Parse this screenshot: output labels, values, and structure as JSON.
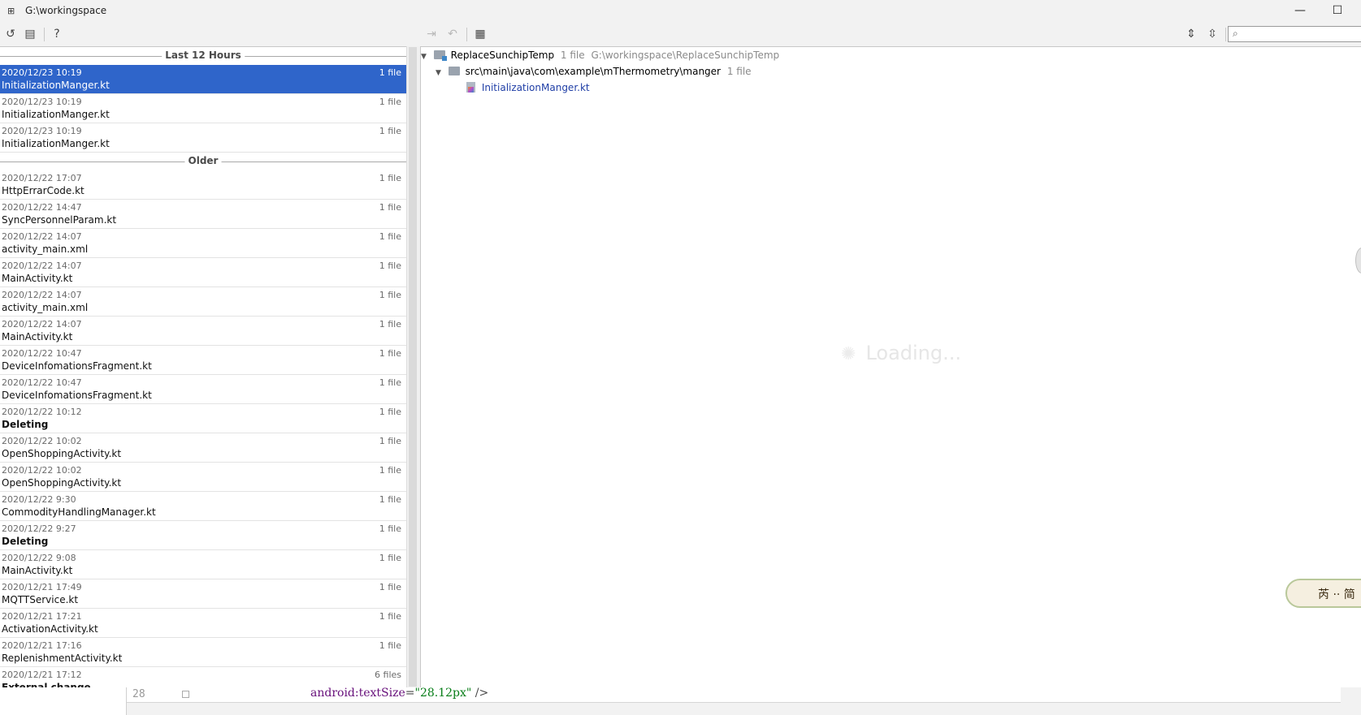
{
  "window": {
    "title": "G:\\workingspace",
    "minimize_glyph": "—",
    "maximize_glyph": "☐"
  },
  "toolbar": {
    "icons": [
      "revert-icon",
      "copy-icon",
      "help-icon",
      "apply-icon",
      "undo-icon",
      "grid-icon",
      "expand-all-icon",
      "collapse-all-icon"
    ],
    "glyphs": {
      "revert": "↺",
      "copy": "▤",
      "help": "?",
      "apply": "⇥",
      "undo": "↶",
      "grid": "▦",
      "expand": "⇕",
      "collapse": "⇳"
    },
    "search": {
      "icon": "⌕",
      "value": "",
      "placeholder": ""
    }
  },
  "history": {
    "groups": [
      {
        "label": "Last 12 Hours",
        "rows": [
          {
            "date": "2020/12/23 10:19",
            "count": "1 file",
            "name": "InitializationManger.kt",
            "selected": true
          },
          {
            "date": "2020/12/23 10:19",
            "count": "1 file",
            "name": "InitializationManger.kt"
          },
          {
            "date": "2020/12/23 10:19",
            "count": "1 file",
            "name": "InitializationManger.kt"
          }
        ]
      },
      {
        "label": "Older",
        "rows": [
          {
            "date": "2020/12/22 17:07",
            "count": "1 file",
            "name": "HttpErrarCode.kt"
          },
          {
            "date": "2020/12/22 14:47",
            "count": "1 file",
            "name": "SyncPersonnelParam.kt"
          },
          {
            "date": "2020/12/22 14:07",
            "count": "1 file",
            "name": "activity_main.xml"
          },
          {
            "date": "2020/12/22 14:07",
            "count": "1 file",
            "name": "MainActivity.kt"
          },
          {
            "date": "2020/12/22 14:07",
            "count": "1 file",
            "name": "activity_main.xml"
          },
          {
            "date": "2020/12/22 14:07",
            "count": "1 file",
            "name": "MainActivity.kt"
          },
          {
            "date": "2020/12/22 10:47",
            "count": "1 file",
            "name": "DeviceInfomationsFragment.kt"
          },
          {
            "date": "2020/12/22 10:47",
            "count": "1 file",
            "name": "DeviceInfomationsFragment.kt"
          },
          {
            "date": "2020/12/22 10:12",
            "count": "1 file",
            "name": "Deleting",
            "bold": true
          },
          {
            "date": "2020/12/22 10:02",
            "count": "1 file",
            "name": "OpenShoppingActivity.kt"
          },
          {
            "date": "2020/12/22 10:02",
            "count": "1 file",
            "name": "OpenShoppingActivity.kt"
          },
          {
            "date": "2020/12/22 9:30",
            "count": "1 file",
            "name": "CommodityHandlingManager.kt"
          },
          {
            "date": "2020/12/22 9:27",
            "count": "1 file",
            "name": "Deleting",
            "bold": true
          },
          {
            "date": "2020/12/22 9:08",
            "count": "1 file",
            "name": "MainActivity.kt"
          },
          {
            "date": "2020/12/21 17:49",
            "count": "1 file",
            "name": "MQTTService.kt"
          },
          {
            "date": "2020/12/21 17:21",
            "count": "1 file",
            "name": "ActivationActivity.kt"
          },
          {
            "date": "2020/12/21 17:16",
            "count": "1 file",
            "name": "ReplenishmentActivity.kt"
          },
          {
            "date": "2020/12/21 17:12",
            "count": "6 files",
            "name": "External change",
            "bold": true
          }
        ]
      }
    ]
  },
  "tree": {
    "root": {
      "name": "ReplaceSunchipTemp",
      "count": "1 file",
      "path": "G:\\workingspace\\ReplaceSunchipTemp"
    },
    "folder": {
      "name": "src\\main\\java\\com\\example\\mThermometry\\manger",
      "count": "1 file"
    },
    "file": {
      "name": "InitializationManger.kt"
    },
    "loading_text": "Loading...",
    "spinner_glyph": "✺",
    "arrow_glyph": "▼"
  },
  "editor": {
    "line_number": "28",
    "code": {
      "attr": "android:textSize",
      "eq": "=",
      "value": "\"28.12px\"",
      "close": " />"
    }
  },
  "overlay": {
    "text": "芮 ·· 简"
  }
}
